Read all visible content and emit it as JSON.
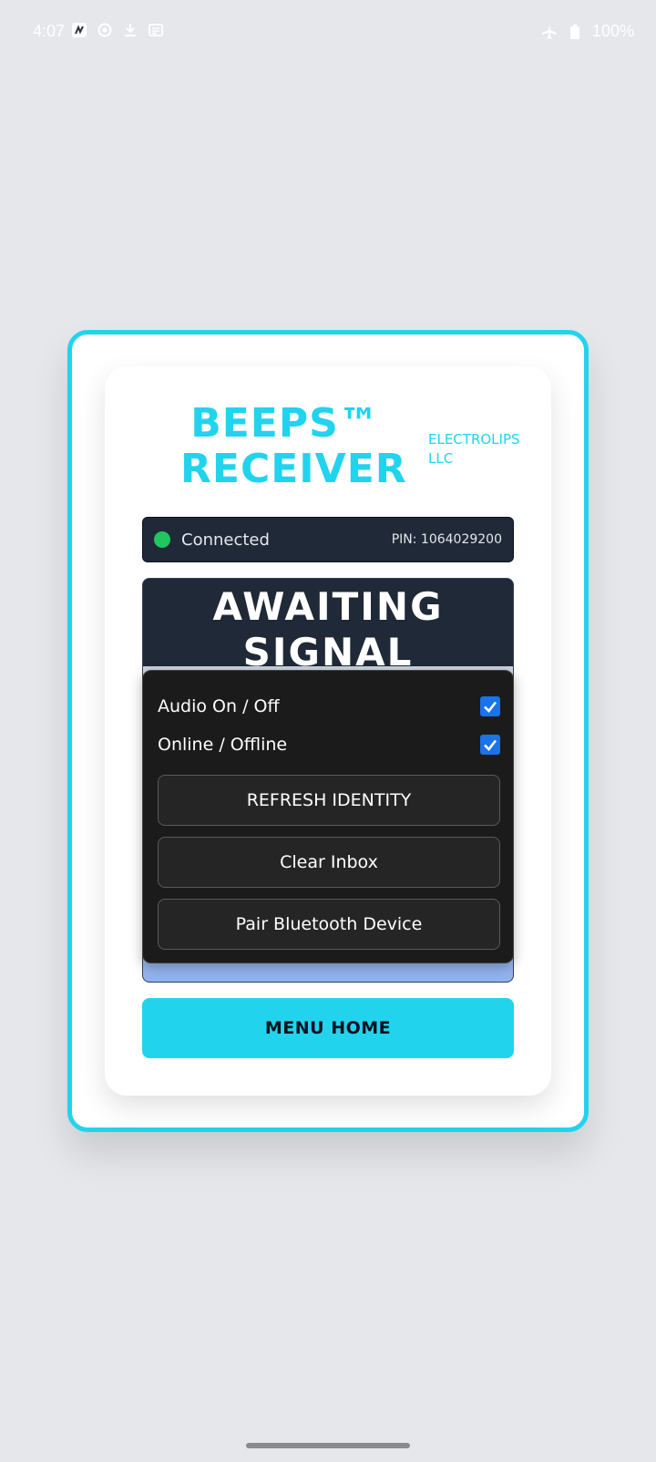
{
  "status_bar": {
    "time": "4:07",
    "battery": "100%"
  },
  "app": {
    "title_line1": "BEEPS™",
    "title_line2": "RECEIVER",
    "brand_line1": "ELECTROLIPS",
    "brand_line2": "LLC",
    "connection_status": "Connected",
    "pin_label": "PIN: 1064029200",
    "signal_line1": "AWAITING",
    "signal_line2": "SIGNAL"
  },
  "menu": {
    "toggles": [
      {
        "label": "Audio On / Off",
        "checked": true
      },
      {
        "label": "Online / Offline",
        "checked": true
      }
    ],
    "buttons": [
      "REFRESH IDENTITY",
      "Clear Inbox",
      "Pair Bluetooth Device"
    ]
  },
  "home_button": "MENU HOME",
  "colors": {
    "accent": "#22d3ee",
    "dark_panel": "#1f2937",
    "connected_dot": "#22c55e",
    "checkbox": "#1a73e8"
  }
}
